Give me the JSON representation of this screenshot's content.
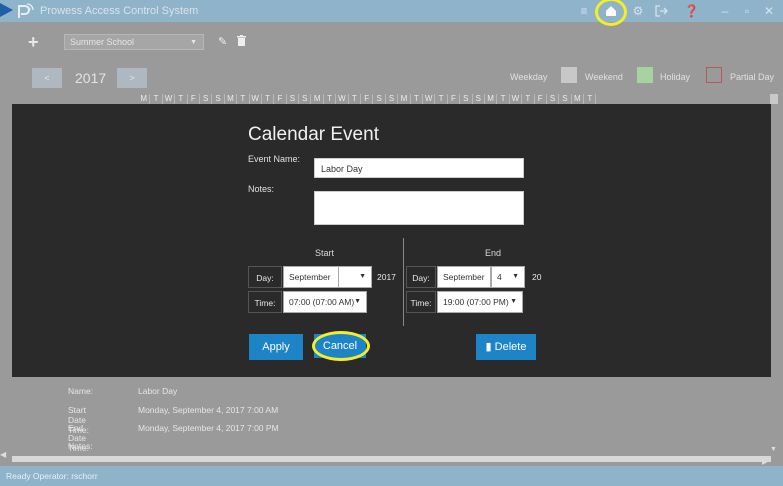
{
  "app": {
    "title": "Prowess Access Control System"
  },
  "titlebar": {
    "icons": [
      "menu-icon",
      "home-icon",
      "gear-icon",
      "logout-icon",
      "help-icon",
      "minimize-icon",
      "maximize-icon",
      "close-icon"
    ]
  },
  "toolbar": {
    "add_label": "+",
    "calendar_select": "Summer School"
  },
  "year_nav": {
    "prev": "<",
    "year": "2017",
    "next": ">",
    "legend": {
      "weekday": "Weekday",
      "weekend": "Weekend",
      "holiday": "Holiday",
      "partial": "Partial Day"
    },
    "weekday_letters": [
      "M",
      "T",
      "W",
      "T",
      "F",
      "S",
      "S",
      "M",
      "T",
      "W",
      "T",
      "F",
      "S",
      "S",
      "M",
      "T",
      "W",
      "T",
      "F",
      "S",
      "S",
      "M",
      "T",
      "W",
      "T",
      "F",
      "S",
      "S",
      "M",
      "T",
      "W",
      "T",
      "F",
      "S",
      "S",
      "M",
      "T"
    ]
  },
  "colors": {
    "weekend_swatch": "#c8c8c8",
    "holiday_swatch": "#a6d3a0",
    "partial_swatch": "#b45a5a",
    "accent": "#1e84c8"
  },
  "modal": {
    "title": "Calendar Event",
    "event_name_label": "Event Name:",
    "event_name_value": "Labor Day",
    "notes_label": "Notes:",
    "notes_value": "",
    "start_header": "Start",
    "end_header": "End",
    "day_label": "Day:",
    "time_label": "Time:",
    "start": {
      "month": "September",
      "day": "",
      "year": "2017",
      "time": "07:00 (07:00 AM)"
    },
    "end": {
      "month": "September",
      "day": "4",
      "year": "20",
      "time": "19:00 (07:00 PM)"
    },
    "apply_label": "Apply",
    "cancel_label": "Cancel",
    "delete_label": "Delete"
  },
  "details": {
    "name_key": "Name:",
    "name_val": "Labor Day",
    "start_key": "Start Date Time:",
    "start_val": "Monday, September 4, 2017 7:00 AM",
    "end_key": "End Date Time:",
    "end_val": "Monday, September 4, 2017 7:00 PM",
    "notes_key": "Notes:",
    "notes_val": ""
  },
  "status": {
    "text": "Ready  Operator: rschorr"
  }
}
